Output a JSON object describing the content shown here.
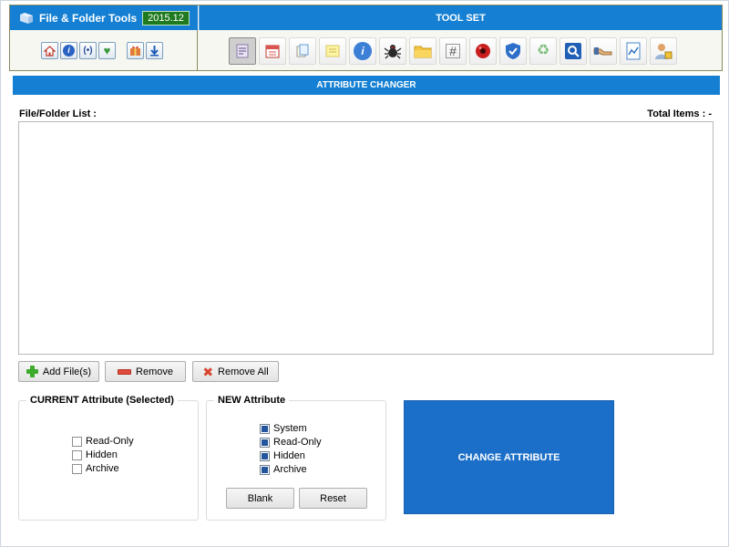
{
  "app": {
    "title": "File & Folder Tools",
    "version": "2015.12"
  },
  "header": {
    "toolset_label": "TOOL SET",
    "nav_icons": [
      "home-icon",
      "info-icon",
      "broadcast-icon",
      "heart-plus-icon",
      "gift-icon",
      "download-icon"
    ],
    "tool_icons": [
      "attribute-changer-icon",
      "calendar-icon",
      "copy-files-icon",
      "note-icon",
      "info-tool-icon",
      "spider-icon",
      "folder-icon",
      "hash-icon",
      "red-ball-icon",
      "shield-icon",
      "recycle-icon",
      "search-icon",
      "handshake-icon",
      "chart-document-icon",
      "user-lock-icon"
    ]
  },
  "section": {
    "title": "ATTRIBUTE CHANGER"
  },
  "list": {
    "label": "File/Folder List :",
    "total_label": "Total Items : -"
  },
  "buttons": {
    "add": "Add File(s)",
    "remove": "Remove",
    "remove_all": "Remove All",
    "blank": "Blank",
    "reset": "Reset",
    "change": "CHANGE ATTRIBUTE"
  },
  "current_attribute": {
    "title": "CURRENT Attribute (Selected)",
    "options": [
      {
        "label": "Read-Only",
        "checked": false
      },
      {
        "label": "Hidden",
        "checked": false
      },
      {
        "label": "Archive",
        "checked": false
      }
    ]
  },
  "new_attribute": {
    "title": "NEW Attribute",
    "options": [
      {
        "label": "System",
        "checked": true
      },
      {
        "label": "Read-Only",
        "checked": true
      },
      {
        "label": "Hidden",
        "checked": true
      },
      {
        "label": "Archive",
        "checked": true
      }
    ]
  },
  "colors": {
    "accent": "#1580d3",
    "action": "#1c6fc8"
  }
}
